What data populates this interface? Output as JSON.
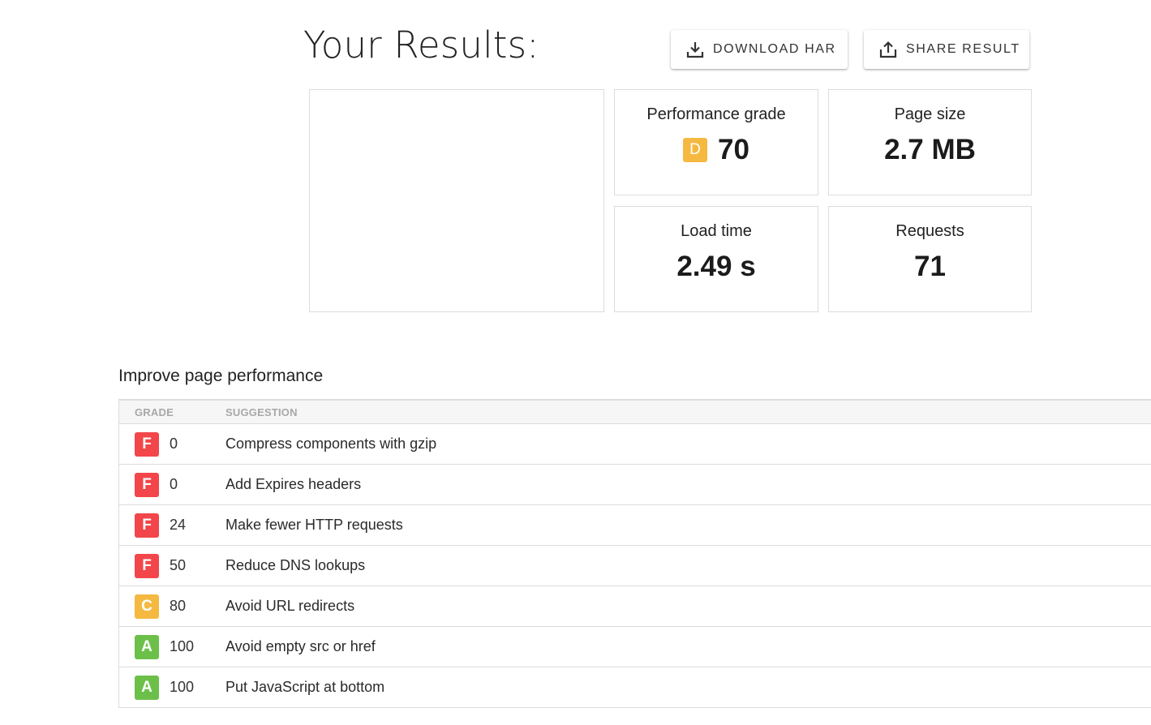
{
  "header": {
    "title": "Your Results:",
    "download_label": "DOWNLOAD HAR",
    "share_label": "SHARE RESULT"
  },
  "metrics": {
    "performance_grade": {
      "label": "Performance grade",
      "letter": "D",
      "value": "70",
      "color": "#f5b941"
    },
    "page_size": {
      "label": "Page size",
      "value": "2.7 MB"
    },
    "load_time": {
      "label": "Load time",
      "value": "2.49 s"
    },
    "requests": {
      "label": "Requests",
      "value": "71"
    }
  },
  "improve": {
    "title": "Improve page performance",
    "columns": {
      "grade": "GRADE",
      "suggestion": "SUGGESTION"
    },
    "rows": [
      {
        "grade": "F",
        "score": "0",
        "suggestion": "Compress components with gzip",
        "color": "#f2464a"
      },
      {
        "grade": "F",
        "score": "0",
        "suggestion": "Add Expires headers",
        "color": "#f2464a"
      },
      {
        "grade": "F",
        "score": "24",
        "suggestion": "Make fewer HTTP requests",
        "color": "#f2464a"
      },
      {
        "grade": "F",
        "score": "50",
        "suggestion": "Reduce DNS lookups",
        "color": "#f2464a"
      },
      {
        "grade": "C",
        "score": "80",
        "suggestion": "Avoid URL redirects",
        "color": "#f5b941"
      },
      {
        "grade": "A",
        "score": "100",
        "suggestion": "Avoid empty src or href",
        "color": "#6cc04a"
      },
      {
        "grade": "A",
        "score": "100",
        "suggestion": "Put JavaScript at bottom",
        "color": "#6cc04a"
      }
    ]
  }
}
